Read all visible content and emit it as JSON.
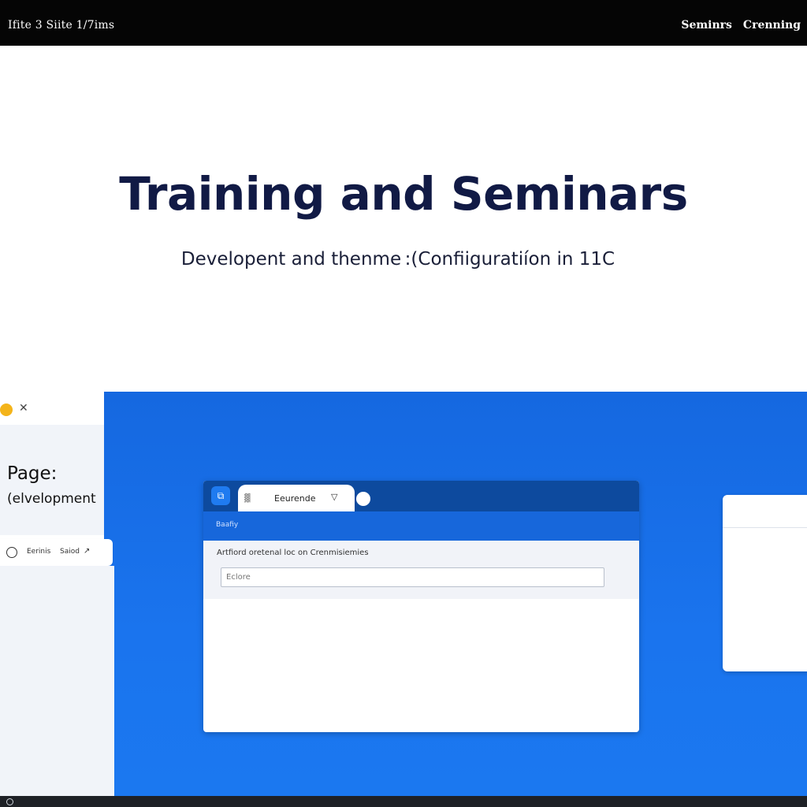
{
  "topbar": {
    "brand": "Ifite 3 Siite 1/7ims",
    "nav": [
      "Seminrs",
      "Crenning"
    ]
  },
  "hero": {
    "title": "Training and Seminars",
    "subtitle": "Developent and thenme :(Confiiguratiíon  in 11C"
  },
  "left_panel": {
    "close_glyph": "✕",
    "page_label": "Page:",
    "page_value": "(elvelopment",
    "chip": {
      "label_1": "Eerinis",
      "label_2": "Saiod",
      "arrow": "↗"
    }
  },
  "browser": {
    "app_icon": "⧉",
    "tab": {
      "icon": "▓",
      "label": "Eeurende",
      "chevron": "▽"
    },
    "address_text": "Baafiy",
    "description": "Artfiord oretenal loc on Crenmisiemies",
    "input": {
      "value": "",
      "placeholder": "Eclore"
    }
  },
  "colors": {
    "topbar_bg": "#050505",
    "title_color": "#111a45",
    "stage_blue": "#1a74ee",
    "tabbar_blue": "#0d4a9e",
    "accent_yellow": "#f4b41a"
  },
  "icons": {
    "close": "close-icon",
    "app": "app-icon",
    "tab_favicon": "tab-favicon-icon",
    "tab_dropdown": "chevron-down-icon",
    "new_tab": "new-tab-icon",
    "chip_avatar": "user-circle-icon"
  }
}
